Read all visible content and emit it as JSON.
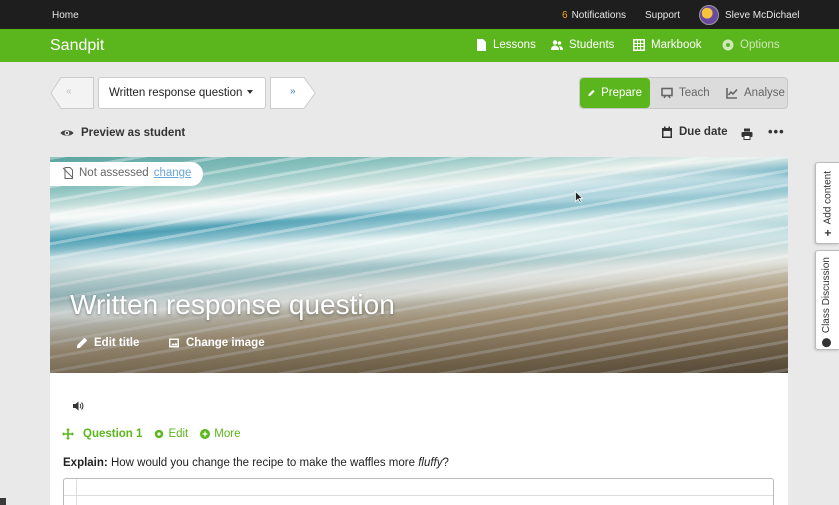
{
  "topbar": {
    "home": "Home",
    "notifications_count": "6",
    "notifications_label": "Notifications",
    "support": "Support",
    "user_name": "Sleve McDichael",
    "avatar_icon": "bee-icon"
  },
  "navbar": {
    "brand": "Sandpit",
    "lessons": "Lessons",
    "students": "Students",
    "markbook": "Markbook",
    "options": "Options",
    "accent": "#5bb51c"
  },
  "controls": {
    "prev": "«",
    "next": "»",
    "dropdown_value": "Written response question",
    "modes": [
      "Prepare",
      "Teach",
      "Analyse"
    ],
    "active_mode": "Prepare",
    "preview": "Preview as student",
    "due_date": "Due date",
    "more": "•••"
  },
  "hero": {
    "assessment_status": "Not assessed",
    "change_link": "change",
    "title": "Written response question",
    "edit_title": "Edit title",
    "change_image": "Change image"
  },
  "question": {
    "label": "Question 1",
    "edit": "Edit",
    "more": "More",
    "explain_label": "Explain:",
    "prompt_start": "How would you change the recipe to make the waffles more ",
    "prompt_emphasis": "fluffy",
    "prompt_end": "?"
  },
  "sidetabs": {
    "add_content": "Add content",
    "class_discussion": "Class Discussion"
  }
}
